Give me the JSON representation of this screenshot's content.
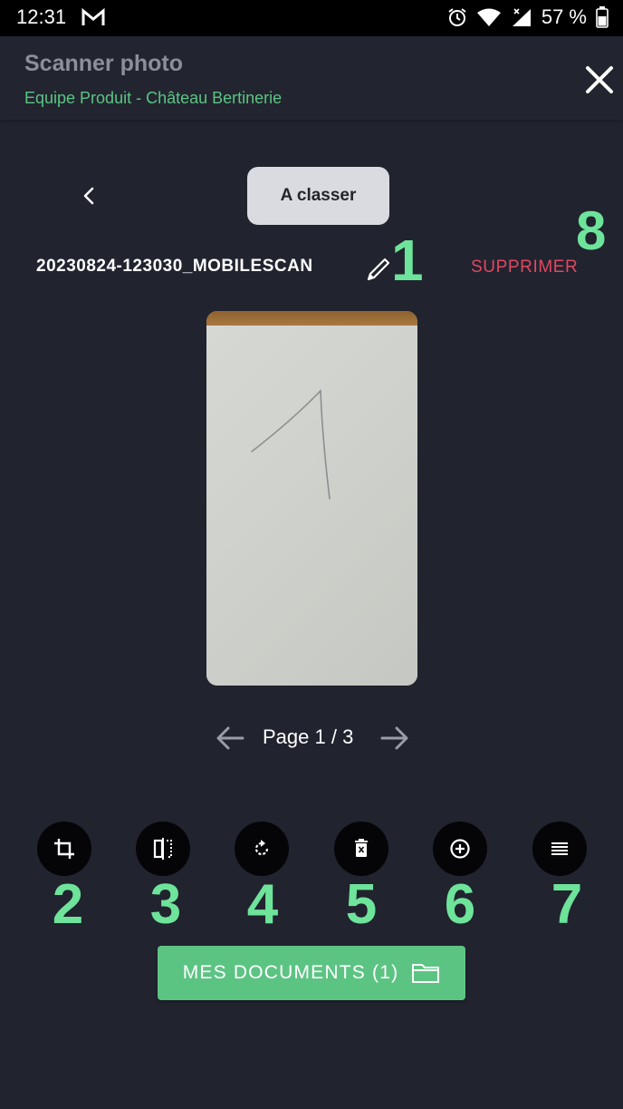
{
  "status_bar": {
    "time": "12:31",
    "battery": "57 %"
  },
  "header": {
    "title": "Scanner photo",
    "subtitle": "Equipe Produit - Château Bertinerie"
  },
  "controls": {
    "classer_label": "A classer",
    "filename": "20230824-123030_MOBILESCAN",
    "delete_label": "SUPPRIMER"
  },
  "pager": {
    "label": "Page 1 / 3"
  },
  "annotations": [
    "1",
    "2",
    "3",
    "4",
    "5",
    "6",
    "7",
    "8"
  ],
  "toolbar": [
    {
      "icon": "crop-icon"
    },
    {
      "icon": "compare-icon"
    },
    {
      "icon": "rotate-icon"
    },
    {
      "icon": "delete-page-icon"
    },
    {
      "icon": "add-icon"
    },
    {
      "icon": "reorder-icon"
    }
  ],
  "bottom": {
    "docs_label": "MES DOCUMENTS (1)"
  },
  "colors": {
    "background": "#21232f",
    "accent": "#5cc483",
    "danger": "#e0485f",
    "annotation": "#6ee39a"
  }
}
